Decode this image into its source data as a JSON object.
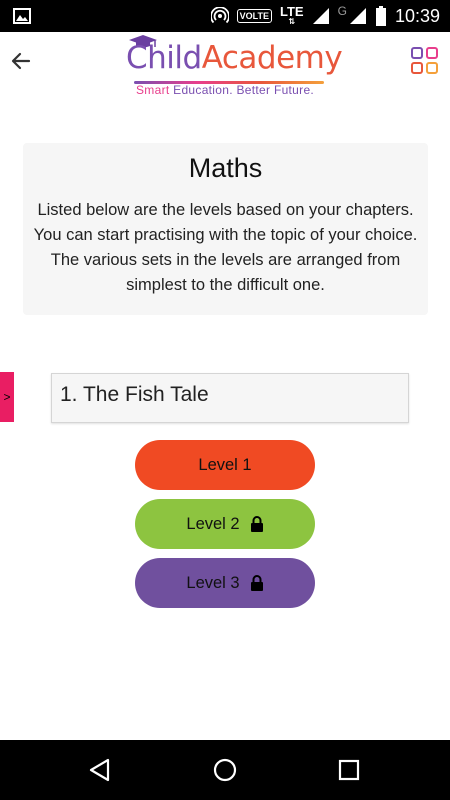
{
  "status_bar": {
    "network_label": "VOLTE",
    "lte_label": "LTE",
    "g_label": "G",
    "time": "10:39"
  },
  "app_bar": {
    "logo": {
      "part1": "Child",
      "part2": "Academy",
      "tagline_smart": "Smart",
      "tagline_rest": " Education. Better Future."
    }
  },
  "info": {
    "title": "Maths",
    "description": "Listed below are the levels based on your chapters. You can start practising with the topic of your choice. The various sets in the levels are arranged from simplest to the difficult one."
  },
  "side_tab": {
    "label": ">"
  },
  "chapter": {
    "title": "1. The Fish Tale"
  },
  "levels": [
    {
      "label": "Level 1",
      "locked": false,
      "color": "#f04a23"
    },
    {
      "label": "Level 2",
      "locked": true,
      "color": "#8dc440"
    },
    {
      "label": "Level 3",
      "locked": true,
      "color": "#70509e"
    }
  ],
  "icons": {
    "back": "arrow-left-icon",
    "grid": "grid-icon",
    "lock": "lock-icon"
  }
}
